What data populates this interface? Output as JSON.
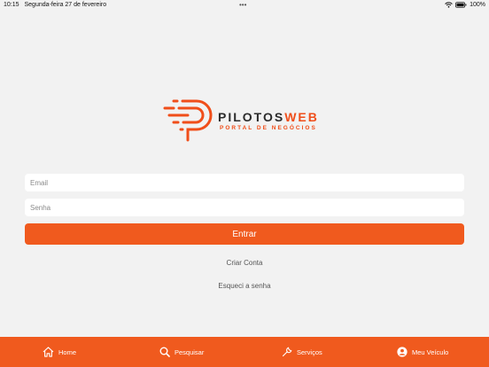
{
  "status_bar": {
    "time": "10:15",
    "date": "Segunda-feira 27 de fevereiro",
    "dots": "•••",
    "battery_percent": "100%",
    "icons": [
      "wifi-icon",
      "battery-icon"
    ]
  },
  "brand": {
    "name_primary": "PILOTOS",
    "name_accent": "WEB",
    "subtitle": "PORTAL DE NEGÓCIOS",
    "accent_color": "#f04e1a"
  },
  "login": {
    "email_placeholder": "Email",
    "password_placeholder": "Senha",
    "submit_label": "Entrar",
    "create_account_label": "Criar Conta",
    "forgot_password_label": "Esqueci a senha"
  },
  "tabbar": {
    "color": "#f05a1e",
    "items": [
      {
        "label": "Home",
        "icon": "home-icon"
      },
      {
        "label": "Pesquisar",
        "icon": "search-icon"
      },
      {
        "label": "Serviços",
        "icon": "wrench-icon"
      },
      {
        "label": "Meu Veículo",
        "icon": "user-circle-icon"
      }
    ]
  }
}
